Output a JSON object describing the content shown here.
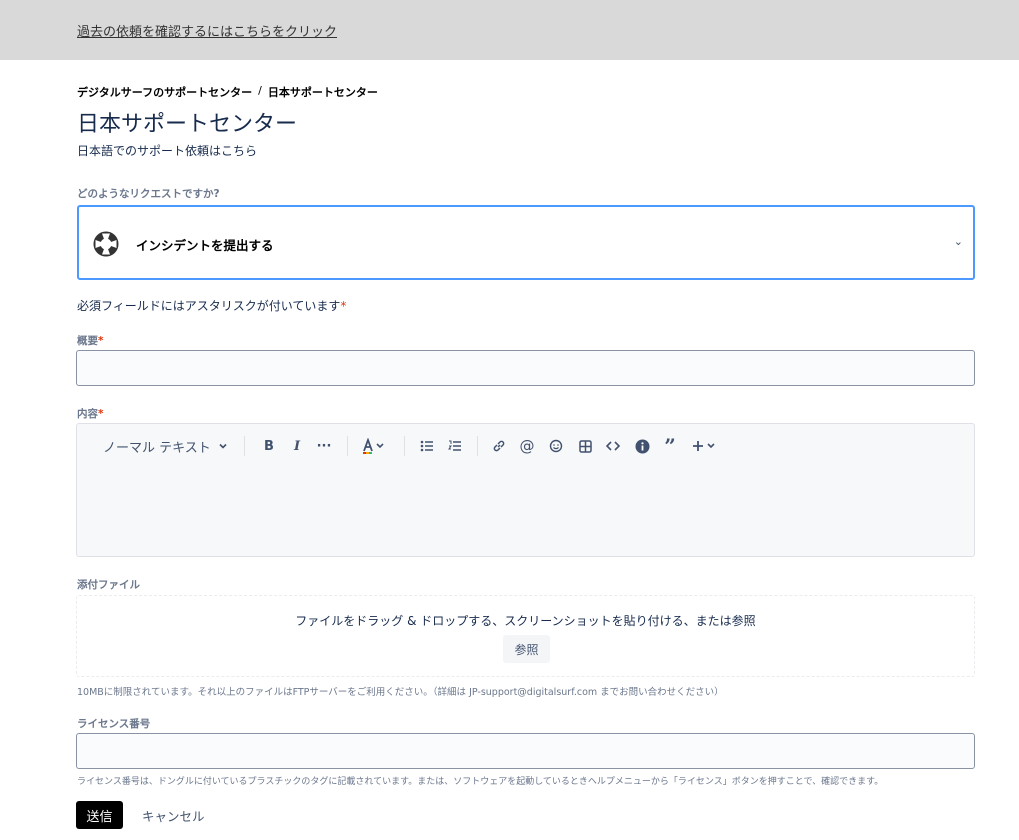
{
  "topbar": {
    "link": "過去の依頼を確認するにはこちらをクリック"
  },
  "breadcrumb": {
    "parent": "デジタルサーフのサポートセンター",
    "separator": "/",
    "current": "日本サポートセンター"
  },
  "page": {
    "title": "日本サポートセンター",
    "subtitle": "日本語でのサポート依頼はこちら"
  },
  "request_type": {
    "label": "どのようなリクエストですか?",
    "value": "インシデントを提出する",
    "icon": "lifebuoy-icon"
  },
  "required_note": {
    "text": "必須フィールドにはアスタリスクが付いています",
    "asterisk": "*"
  },
  "summary": {
    "label": "概要",
    "asterisk": "*",
    "value": "",
    "placeholder": ""
  },
  "description": {
    "label": "内容",
    "asterisk": "*",
    "toolbar": {
      "text_style": "ノーマル テキスト",
      "buttons": [
        "bold-icon",
        "italic-icon",
        "more-icon",
        "text-color-icon",
        "bullet-list-icon",
        "numbered-list-icon",
        "link-icon",
        "mention-icon",
        "emoji-icon",
        "table-icon",
        "code-icon",
        "info-icon",
        "quote-icon",
        "insert-plus-icon"
      ]
    },
    "value": ""
  },
  "attachments": {
    "label": "添付ファイル",
    "drop_text": "ファイルをドラッグ & ドロップする、スクリーンショットを貼り付ける、または参照",
    "browse": "参照",
    "help": "10MBに制限されています。それ以上のファイルはFTPサーバーをご利用ください。（詳細は JP-support@digitalsurf.com までお問い合わせください）"
  },
  "license": {
    "label": "ライセンス番号",
    "value": "",
    "help": "ライセンス番号は、ドングルに付いているプラスチックのタグに記載されています。または、ソフトウェアを起動しているときヘルプメニューから「ライセンス」ボタンを押すことで、確認できます。"
  },
  "actions": {
    "submit": "送信",
    "cancel": "キャンセル"
  },
  "colors": {
    "accent": "#4c9aff",
    "required": "#de350b",
    "topbar": "#d9d9d9"
  }
}
